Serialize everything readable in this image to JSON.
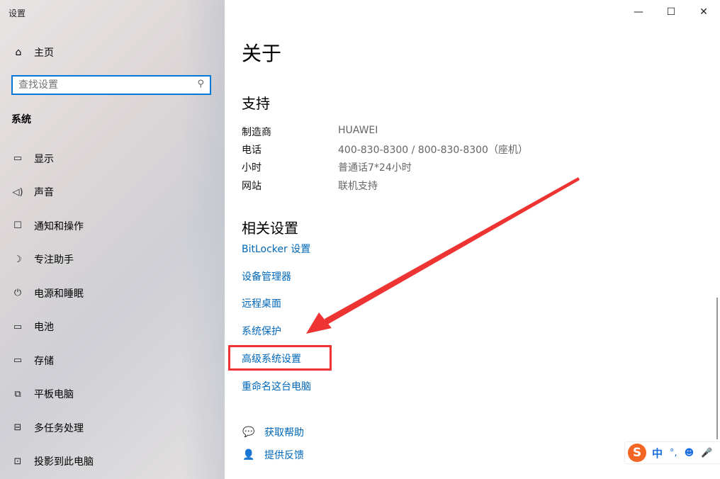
{
  "window": {
    "title": "设置",
    "minimize": "—",
    "maximize": "☐",
    "close": "✕"
  },
  "sidebar": {
    "home_label": "主页",
    "search_placeholder": "查找设置",
    "section_title": "系统",
    "items": [
      {
        "label": "显示",
        "icon": "monitor-icon"
      },
      {
        "label": "声音",
        "icon": "speaker-icon"
      },
      {
        "label": "通知和操作",
        "icon": "notification-icon"
      },
      {
        "label": "专注助手",
        "icon": "moon-icon"
      },
      {
        "label": "电源和睡眠",
        "icon": "power-icon"
      },
      {
        "label": "电池",
        "icon": "battery-icon"
      },
      {
        "label": "存储",
        "icon": "storage-icon"
      },
      {
        "label": "平板电脑",
        "icon": "tablet-icon"
      },
      {
        "label": "多任务处理",
        "icon": "multitask-icon"
      },
      {
        "label": "投影到此电脑",
        "icon": "projection-icon"
      }
    ]
  },
  "main": {
    "title": "关于",
    "support": {
      "heading": "支持",
      "rows": [
        {
          "key": "制造商",
          "value": "HUAWEI"
        },
        {
          "key": "电话",
          "value": "400-830-8300 / 800-830-8300（座机）"
        },
        {
          "key": "小时",
          "value": "普通话7*24小时"
        },
        {
          "key": "网站",
          "value": "联机支持"
        }
      ]
    },
    "related": {
      "heading": "相关设置",
      "links": [
        "BitLocker 设置",
        "设备管理器",
        "远程桌面",
        "系统保护",
        "高级系统设置",
        "重命名这台电脑"
      ]
    },
    "help": {
      "get_help": "获取帮助",
      "feedback": "提供反馈"
    }
  },
  "ime": {
    "logo": "S",
    "mode": "中",
    "symbols": "°,",
    "emoji": "☻",
    "mic": "🎤"
  },
  "colors": {
    "accent": "#0078d7",
    "link": "#0067b8",
    "annotation": "#ee3333"
  }
}
